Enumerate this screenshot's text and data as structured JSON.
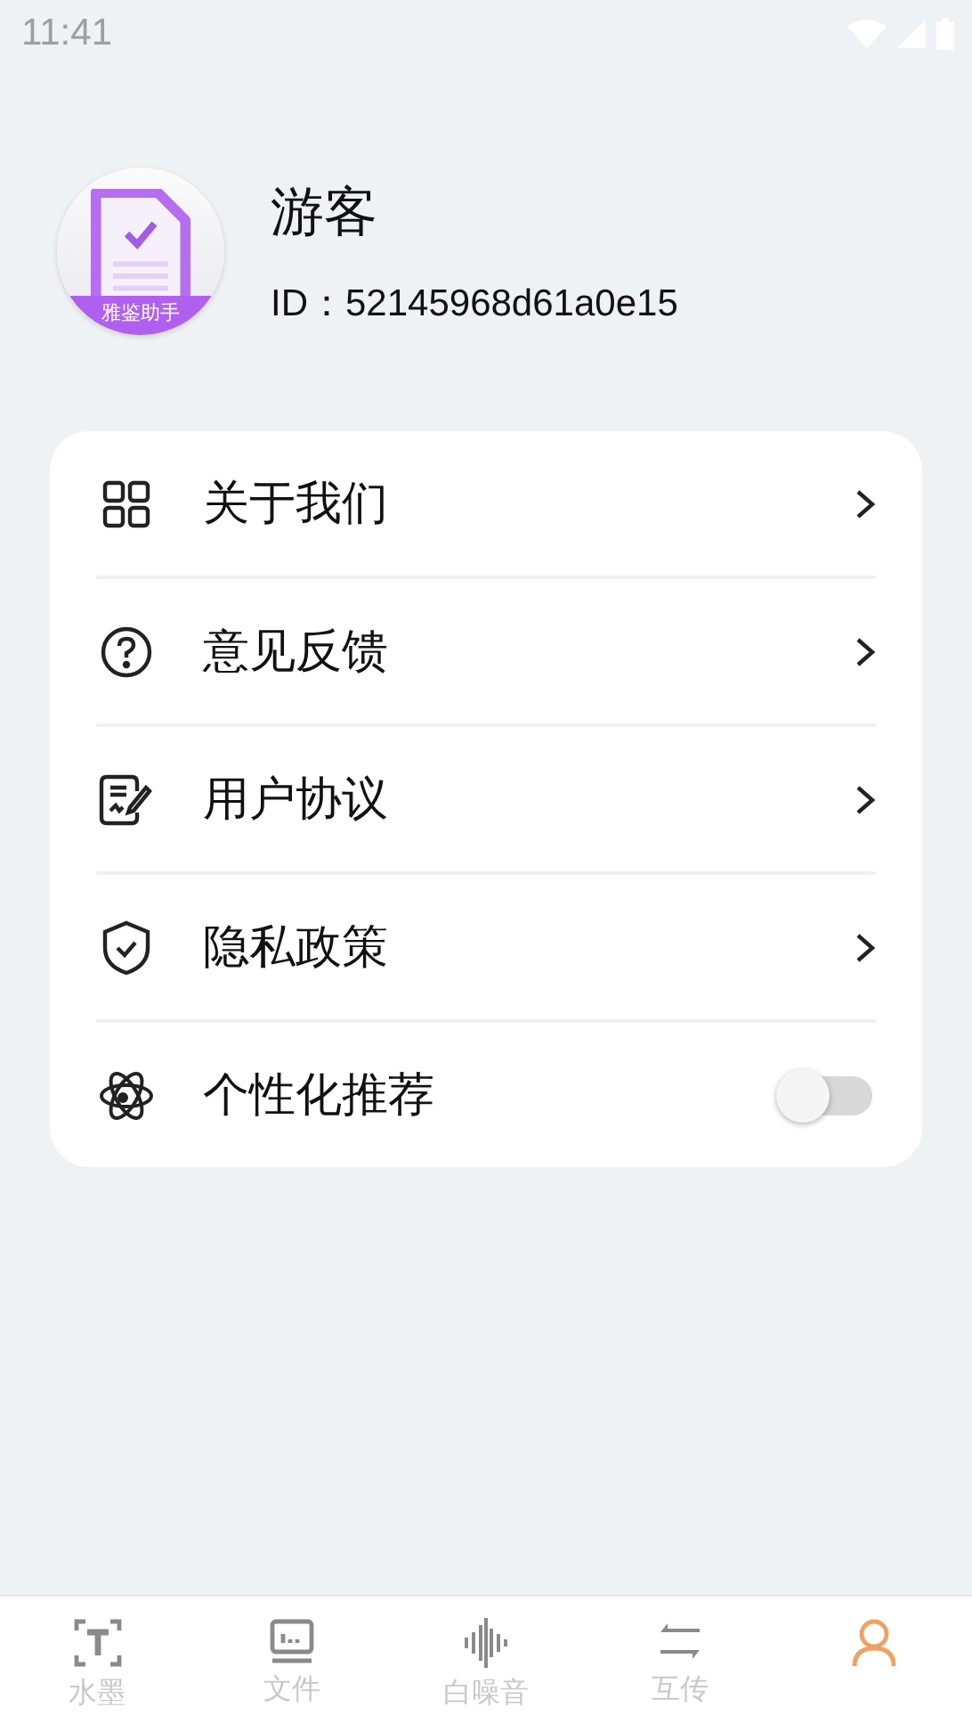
{
  "status_bar": {
    "time": "11:41"
  },
  "profile": {
    "avatar_label": "雅鉴助手",
    "name": "游客",
    "id": "ID：52145968d61a0e15"
  },
  "menu": [
    {
      "kind": "link",
      "label": "关于我们"
    },
    {
      "kind": "link",
      "label": "意见反馈"
    },
    {
      "kind": "link",
      "label": "用户协议"
    },
    {
      "kind": "link",
      "label": "隐私政策"
    },
    {
      "kind": "toggle",
      "label": "个性化推荐",
      "on": false
    }
  ],
  "tabs": [
    {
      "label": "水墨",
      "selected": false
    },
    {
      "label": "文件",
      "selected": false
    },
    {
      "label": "白噪音",
      "selected": false
    },
    {
      "label": "互传",
      "selected": false
    },
    {
      "selected": true
    }
  ]
}
